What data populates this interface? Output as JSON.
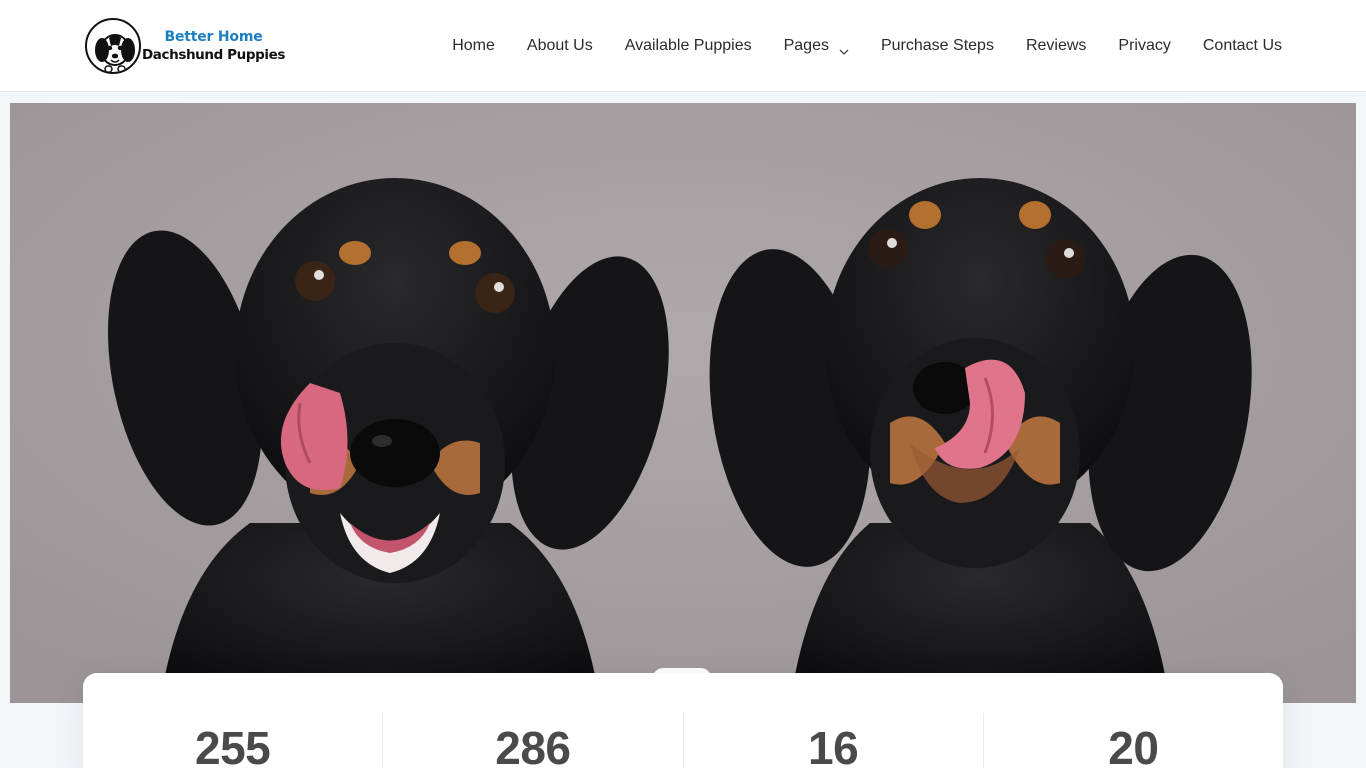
{
  "brand": {
    "line1": "Better Home",
    "line2": "Dachshund Puppies",
    "accent_color": "#1c7fc0"
  },
  "nav": {
    "items": [
      {
        "label": "Home"
      },
      {
        "label": "About Us"
      },
      {
        "label": "Available Puppies"
      },
      {
        "label": "Pages",
        "has_dropdown": true,
        "icon": "chevron-down-icon"
      },
      {
        "label": "Purchase Steps"
      },
      {
        "label": "Reviews"
      },
      {
        "label": "Privacy"
      },
      {
        "label": "Contact Us"
      }
    ]
  },
  "hero": {
    "image": "two-dachshund-puppies-licking-lips",
    "background_color": "#a8a1a3"
  },
  "stats": [
    {
      "value": "255"
    },
    {
      "value": "286"
    },
    {
      "value": "16"
    },
    {
      "value": "20"
    }
  ]
}
